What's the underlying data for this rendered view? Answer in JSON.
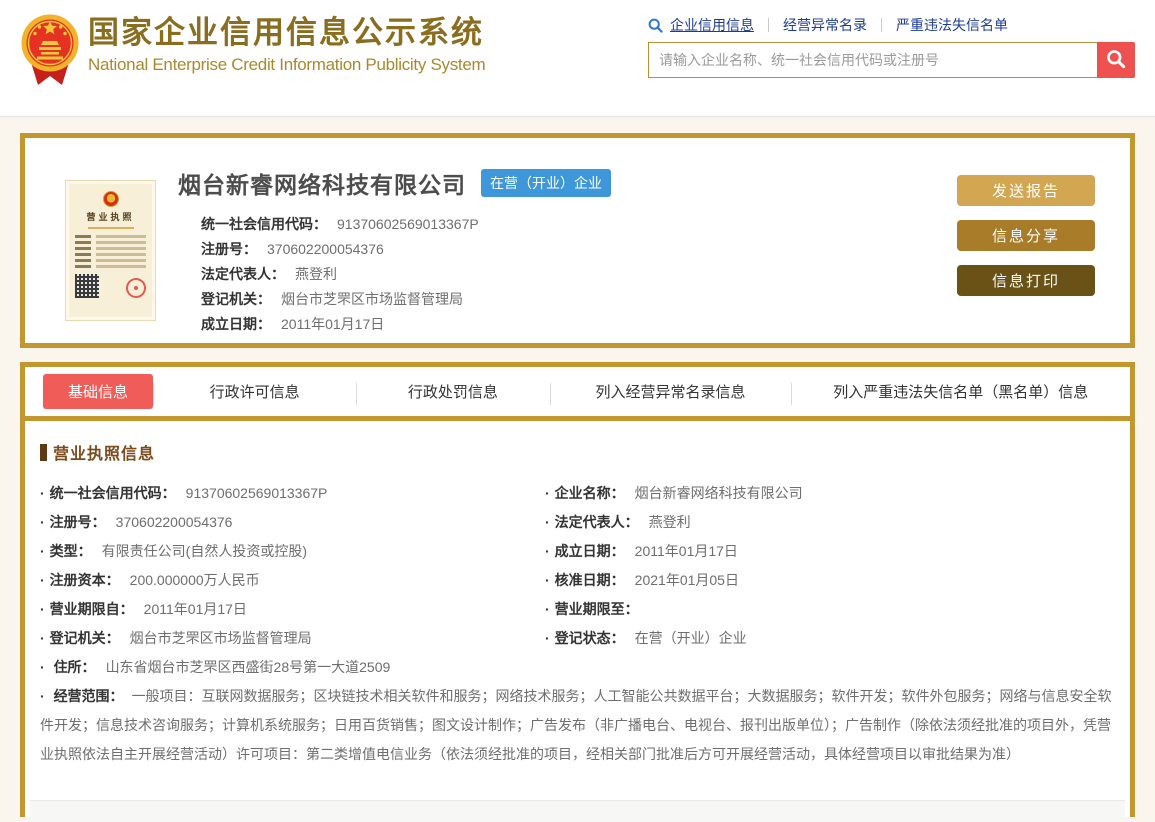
{
  "header": {
    "site_title": "国家企业信用信息公示系统",
    "site_subtitle": "National Enterprise Credit Information Publicity System",
    "nav_links": [
      {
        "label": "企业信用信息",
        "active": true
      },
      {
        "label": "经营异常名录",
        "active": false
      },
      {
        "label": "严重违法失信名单",
        "active": false
      }
    ],
    "search": {
      "placeholder": "请输入企业名称、统一社会信用代码或注册号"
    }
  },
  "summary_card": {
    "company_name": "烟台新睿网络科技有限公司",
    "status_badge": "在营（开业）企业",
    "license_thumb_title": "营业执照",
    "fields": [
      {
        "label": "统一社会信用代码：",
        "value": "91370602569013367P"
      },
      {
        "label": "注册号：",
        "value": "370602200054376"
      },
      {
        "label": "法定代表人：",
        "value": "燕登利"
      },
      {
        "label": "登记机关：",
        "value": "烟台市芝罘区市场监督管理局"
      },
      {
        "label": "成立日期：",
        "value": "2011年01月17日"
      }
    ],
    "actions": [
      {
        "label": "发送报告"
      },
      {
        "label": "信息分享"
      },
      {
        "label": "信息打印"
      }
    ]
  },
  "tabs": [
    {
      "label": "基础信息",
      "active": true
    },
    {
      "label": "行政许可信息",
      "active": false
    },
    {
      "label": "行政处罚信息",
      "active": false
    },
    {
      "label": "列入经营异常名录信息",
      "active": false
    },
    {
      "label": "列入严重违法失信名单（黑名单）信息",
      "active": false
    }
  ],
  "license_section": {
    "title": "营业执照信息",
    "left_fields": [
      {
        "label": "统一社会信用代码：",
        "value": "91370602569013367P"
      },
      {
        "label": "注册号：",
        "value": "370602200054376"
      },
      {
        "label": "类型：",
        "value": "有限责任公司(自然人投资或控股)"
      },
      {
        "label": "注册资本：",
        "value": "200.000000万人民币"
      },
      {
        "label": "营业期限自：",
        "value": "2011年01月17日"
      },
      {
        "label": "登记机关：",
        "value": "烟台市芝罘区市场监督管理局"
      }
    ],
    "right_fields": [
      {
        "label": "企业名称：",
        "value": "烟台新睿网络科技有限公司"
      },
      {
        "label": "法定代表人：",
        "value": "燕登利"
      },
      {
        "label": "成立日期：",
        "value": "2011年01月17日"
      },
      {
        "label": "核准日期：",
        "value": "2021年01月05日"
      },
      {
        "label": "营业期限至：",
        "value": ""
      },
      {
        "label": "登记状态：",
        "value": "在营（开业）企业"
      }
    ],
    "full_fields": [
      {
        "label": "住所：",
        "value": "山东省烟台市芝罘区西盛街28号第一大道2509"
      },
      {
        "label": "经营范围：",
        "value": "一般项目：互联网数据服务；区块链技术相关软件和服务；网络技术服务；人工智能公共数据平台；大数据服务；软件开发；软件外包服务；网络与信息安全软件开发；信息技术咨询服务；计算机系统服务；日用百货销售；图文设计制作；广告发布（非广播电台、电视台、报刊出版单位）；广告制作（除依法须经批准的项目外，凭营业执照依法自主开展经营活动）许可项目：第二类增值电信业务（依法须经批准的项目，经相关部门批准后方可开展经营活动，具体经营项目以审批结果为准）"
      }
    ]
  },
  "colors": {
    "gold_border": "#c3972f",
    "title_gold": "#8a6d1f",
    "subtitle_gold": "#a9892e",
    "nav_link_blue": "#1e3c94",
    "search_button_red": "#ef5151",
    "active_tab_red": "#f05d59",
    "status_badge_blue": "#3e97d8",
    "action_button_light": "#d3a751",
    "action_button_medium": "#a87c28",
    "action_button_dark": "#6a5115",
    "section_title_brown": "#7d4a1b",
    "page_background": "#faf6ee"
  }
}
